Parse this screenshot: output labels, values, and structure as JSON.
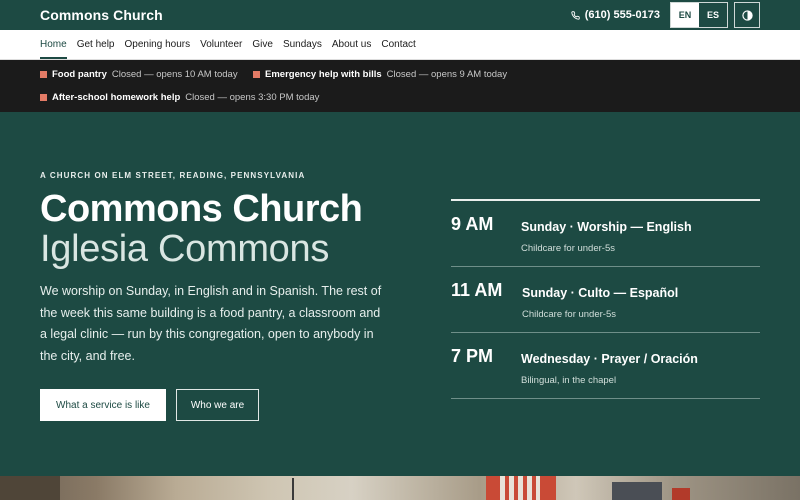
{
  "header": {
    "brand": "Commons Church",
    "phone": "(610) 555-0173",
    "lang_en": "EN",
    "lang_es": "ES",
    "active_lang": "EN"
  },
  "nav": {
    "items": [
      {
        "label": "Home",
        "current": true
      },
      {
        "label": "Get help"
      },
      {
        "label": "Opening hours"
      },
      {
        "label": "Volunteer"
      },
      {
        "label": "Give"
      },
      {
        "label": "Sundays"
      },
      {
        "label": "About us"
      },
      {
        "label": "Contact"
      }
    ]
  },
  "alerts": [
    {
      "name": "Food pantry",
      "status": "Closed — opens 10 AM today"
    },
    {
      "name": "Emergency help with bills",
      "status": "Closed — opens 9 AM today"
    },
    {
      "name": "After-school homework help",
      "status": "Closed — opens 3:30 PM today"
    }
  ],
  "hero": {
    "kicker": "A CHURCH ON ELM STREET, READING, PENNSYLVANIA",
    "title": "Commons Church",
    "subtitle": "Iglesia Commons",
    "lede": "We worship on Sunday, in English and in Spanish. The rest of the week this same building is a food pantry, a classroom and a legal clinic — run by this congregation, open to anybody in the city, and free.",
    "primary_button": "What a service is like",
    "secondary_button": "Who we are"
  },
  "schedule": [
    {
      "time": "9 AM",
      "title": "Sunday · Worship — English",
      "note": "Childcare for under-5s"
    },
    {
      "time": "11 AM",
      "title": "Sunday · Culto — Español",
      "note": "Childcare for under-5s"
    },
    {
      "time": "7 PM",
      "title": "Wednesday · Prayer / Oración",
      "note": "Bilingual, in the chapel"
    }
  ],
  "colors": {
    "brand_green": "#1d4a43",
    "alert_bar": "#1b1b1b",
    "alert_marker": "#e37b66"
  },
  "icons": {
    "phone": "phone-icon",
    "contrast": "contrast-icon"
  }
}
